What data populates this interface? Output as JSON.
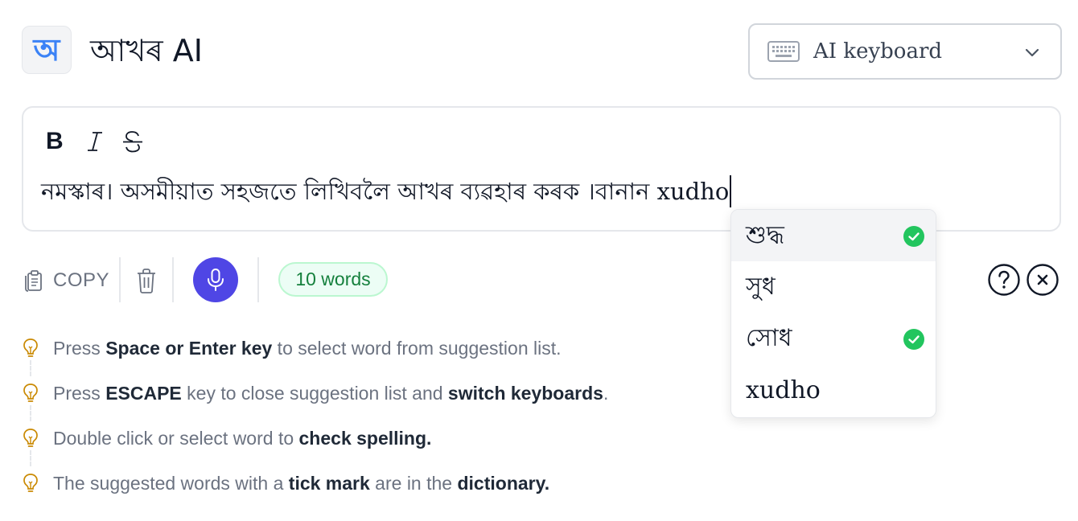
{
  "header": {
    "logo_glyph": "অ",
    "app_title": "আখৰ AI",
    "keyboard_select": {
      "selected": "AI keyboard",
      "icon": "keyboard-icon"
    }
  },
  "editor": {
    "format_buttons": {
      "bold": "B",
      "italic": "I",
      "strike": "S"
    },
    "text_bengali": "নমস্কাৰ। অসমীয়াত সহজতে লিখিবলৈ আখৰ ব্যৱহাৰ কৰক ।বানান",
    "text_current_word": "xudho"
  },
  "suggestions": [
    {
      "word": "শুদ্ধ",
      "in_dictionary": true,
      "active": true
    },
    {
      "word": "সুধ",
      "in_dictionary": false,
      "active": false
    },
    {
      "word": "সোধ",
      "in_dictionary": true,
      "active": false
    },
    {
      "word": "xudho",
      "in_dictionary": false,
      "active": false
    }
  ],
  "toolbar": {
    "copy_label": "COPY",
    "word_count": "10 words",
    "icons": [
      "copy-icon",
      "trash-icon",
      "microphone-icon",
      "help-icon",
      "close-icon"
    ]
  },
  "tips": [
    {
      "pre": "Press ",
      "b1": "Space or Enter key",
      "mid": " to select word from suggestion list.",
      "b2": "",
      "post": ""
    },
    {
      "pre": "Press ",
      "b1": "ESCAPE",
      "mid": " key to close suggestion list and ",
      "b2": "switch keyboards",
      "post": "."
    },
    {
      "pre": "Double click or select word to ",
      "b1": "check spelling.",
      "mid": "",
      "b2": "",
      "post": ""
    },
    {
      "pre": "The suggested words with a ",
      "b1": "tick mark",
      "mid": " are in the ",
      "b2": "dictionary.",
      "post": ""
    }
  ],
  "colors": {
    "accent": "#4f46e5",
    "logo": "#3b82f6",
    "tick": "#22c55e",
    "badge_text": "#15803d",
    "tip_icon": "#ca8a04"
  }
}
